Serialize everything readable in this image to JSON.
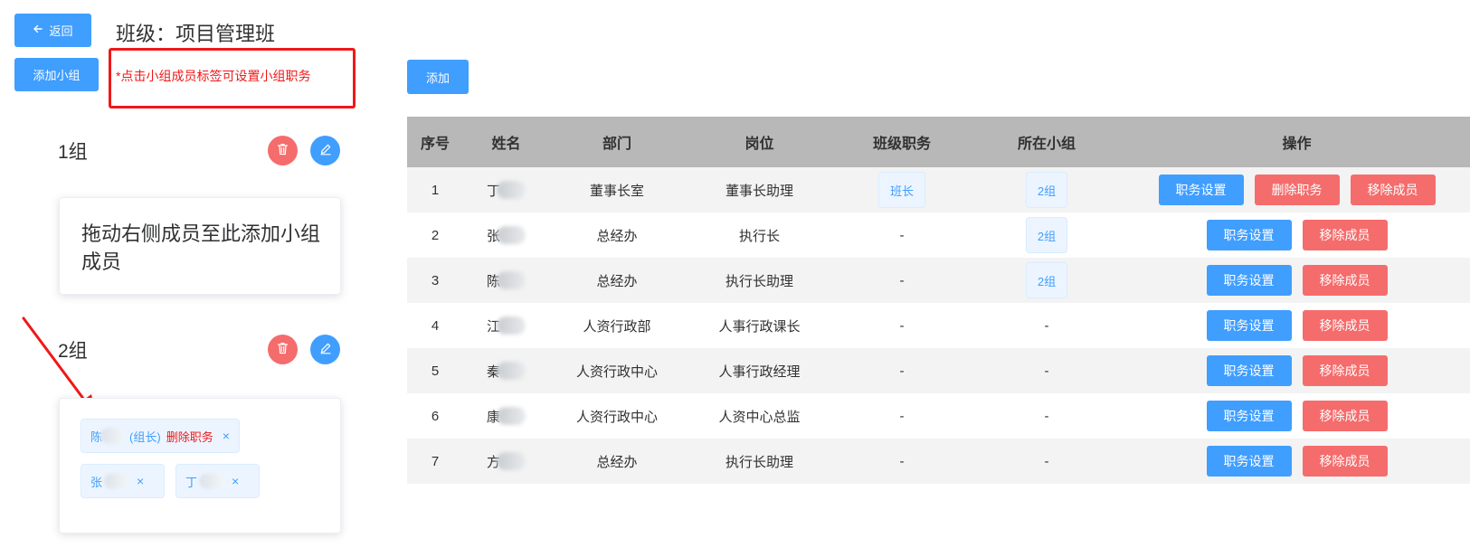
{
  "header": {
    "back_label": "返回",
    "title": "班级：项目管理班"
  },
  "toolbar": {
    "add_group_label": "添加小组",
    "hint": "*点击小组成员标签可设置小组职务",
    "add_member_label": "添加"
  },
  "groups": [
    {
      "name": "1组",
      "placeholder": "拖动右侧成员至此添加小组成员"
    },
    {
      "name": "2组",
      "tags": [
        {
          "name_prefix": "陈",
          "role": "(组长)",
          "action": "删除职务",
          "close": "×"
        },
        {
          "name_prefix": "张",
          "close": "×"
        },
        {
          "name_prefix": "丁",
          "close": "×"
        }
      ]
    }
  ],
  "table": {
    "headers": [
      "序号",
      "姓名",
      "部门",
      "岗位",
      "班级职务",
      "所在小组",
      "操作"
    ],
    "rows": [
      {
        "no": "1",
        "name": "丁",
        "dept": "董事长室",
        "post": "董事长助理",
        "class_role": "班长",
        "group": "2组",
        "actions": [
          "职务设置",
          "删除职务",
          "移除成员"
        ]
      },
      {
        "no": "2",
        "name": "张",
        "dept": "总经办",
        "post": "执行长",
        "class_role": "-",
        "group": "2组",
        "actions": [
          "职务设置",
          "移除成员"
        ]
      },
      {
        "no": "3",
        "name": "陈",
        "dept": "总经办",
        "post": "执行长助理",
        "class_role": "-",
        "group": "2组",
        "actions": [
          "职务设置",
          "移除成员"
        ]
      },
      {
        "no": "4",
        "name": "江",
        "dept": "人资行政部",
        "post": "人事行政课长",
        "class_role": "-",
        "group": "-",
        "actions": [
          "职务设置",
          "移除成员"
        ]
      },
      {
        "no": "5",
        "name": "秦",
        "dept": "人资行政中心",
        "post": "人事行政经理",
        "class_role": "-",
        "group": "-",
        "actions": [
          "职务设置",
          "移除成员"
        ]
      },
      {
        "no": "6",
        "name": "康",
        "dept": "人资行政中心",
        "post": "人资中心总监",
        "class_role": "-",
        "group": "-",
        "actions": [
          "职务设置",
          "移除成员"
        ]
      },
      {
        "no": "7",
        "name": "方",
        "dept": "总经办",
        "post": "执行长助理",
        "class_role": "-",
        "group": "-",
        "actions": [
          "职务设置",
          "移除成员"
        ]
      }
    ]
  },
  "colors": {
    "primary": "#409eff",
    "danger": "#f56c6c",
    "annotation_red": "#f01818",
    "header_bg": "#b8b8b8"
  }
}
